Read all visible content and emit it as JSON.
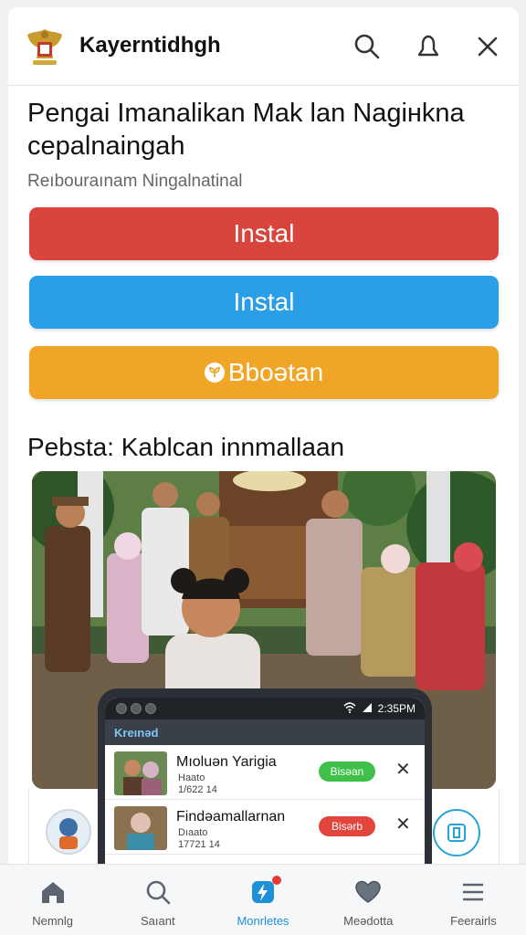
{
  "header": {
    "app_title": "Kayerntidhgh",
    "icons": [
      "search-icon",
      "bell-icon",
      "close-icon"
    ]
  },
  "content": {
    "title": "Pengai Imanalikan Mak lan Nagiнkna cepalnaingah",
    "subtitle": "Reıbouraınam Ningalnatinal",
    "buttons": [
      {
        "label": "Instal",
        "color": "#d9443c"
      },
      {
        "label": "Instal",
        "color": "#2b9ee8"
      },
      {
        "label": "Bboətan",
        "color": "#f0a526",
        "icon": "leaf-icon"
      }
    ],
    "gallery_title": "Pebsta: Kablcan innmallaan"
  },
  "phone": {
    "status_time": "2:35PM",
    "app_label": "Kreınəd",
    "rows": [
      {
        "title": "Mıoluən Yarigia",
        "meta1": "Наato",
        "meta2": "1/622  14",
        "tag": "Bisəan",
        "tag_color": "green"
      },
      {
        "title": "Findəamallarnan",
        "meta1": "Dıaato",
        "meta2": "17721  14",
        "tag": "Bisərb",
        "tag_color": "red"
      }
    ]
  },
  "nav": {
    "items": [
      {
        "label": "Nemnlg",
        "icon": "home-icon"
      },
      {
        "label": "Saıant",
        "icon": "search-icon"
      },
      {
        "label": "Monrletes",
        "icon": "bolt-icon",
        "active": true
      },
      {
        "label": "Meədotta",
        "icon": "heart-icon"
      },
      {
        "label": "Feerairls",
        "icon": "menu-icon"
      }
    ]
  },
  "colors": {
    "accent": "#1f8fd6",
    "red": "#d9443c",
    "blue": "#2b9ee8",
    "orange": "#f0a526"
  }
}
